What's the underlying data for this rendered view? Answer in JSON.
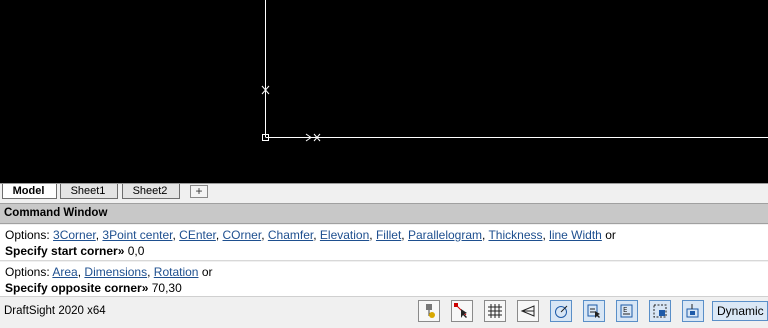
{
  "tabs": [
    {
      "label": "Model"
    },
    {
      "label": "Sheet1"
    },
    {
      "label": "Sheet2"
    }
  ],
  "tab_add_label": "+",
  "command_window": {
    "title": "Command Window",
    "block1": {
      "options_prefix": "Options:",
      "options": [
        "3Corner",
        "3Point center",
        "CEnter",
        "COrner",
        "Chamfer",
        "Elevation",
        "Fillet",
        "Parallelogram",
        "Thickness",
        "line Width"
      ],
      "options_suffix": "or",
      "prompt_label": "Specify start corner»",
      "prompt_value": "0,0"
    },
    "block2": {
      "options_prefix": "Options:",
      "options": [
        "Area",
        "Dimensions",
        "Rotation"
      ],
      "options_suffix": "or",
      "prompt_label": "Specify opposite corner»",
      "prompt_value": "70,30"
    }
  },
  "status": {
    "app_label": "DraftSight 2020 x64",
    "dynamic_label": "Dynamic"
  },
  "colors": {
    "canvas_bg": "#000000",
    "option_link": "#1e4f8f",
    "active_toggle": "#d8e6f5"
  }
}
